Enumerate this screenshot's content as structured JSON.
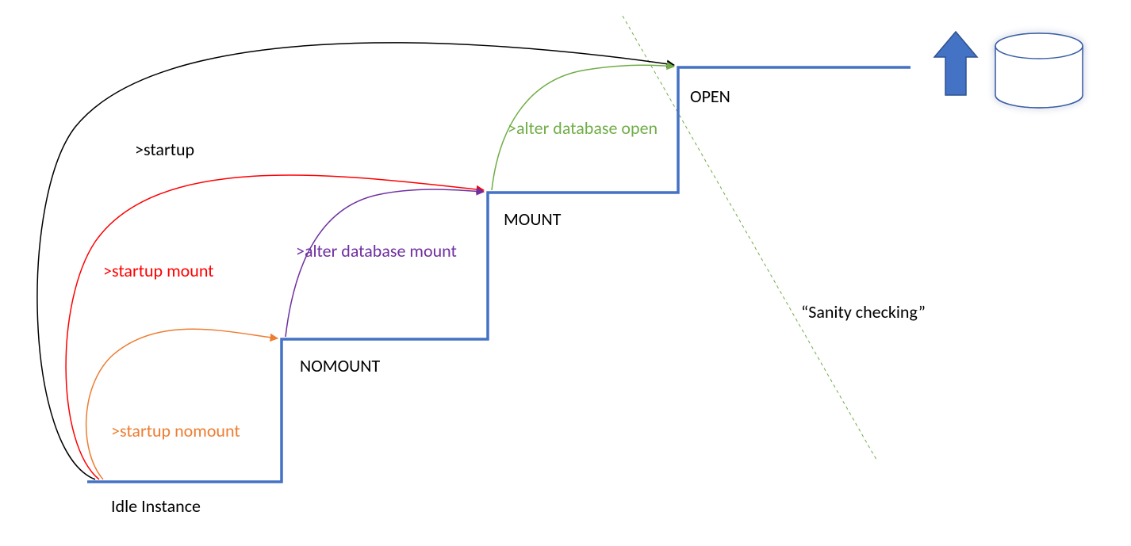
{
  "states": {
    "idle": "Idle Instance",
    "nomount": "NOMOUNT",
    "mount": "MOUNT",
    "open": "OPEN"
  },
  "commands": {
    "startup": ">startup",
    "startup_mount": ">startup mount",
    "startup_nomount": ">startup nomount",
    "alter_mount": ">alter database mount",
    "alter_open": ">alter database open"
  },
  "note": "“Sanity checking”",
  "colors": {
    "stair": "#4472C4",
    "startup": "#000000",
    "startup_mount": "#FF0000",
    "startup_nomount": "#ED7D31",
    "alter_mount": "#7030A0",
    "alter_open": "#70AD47",
    "dash": "#70AD47",
    "state_text": "#000000"
  }
}
